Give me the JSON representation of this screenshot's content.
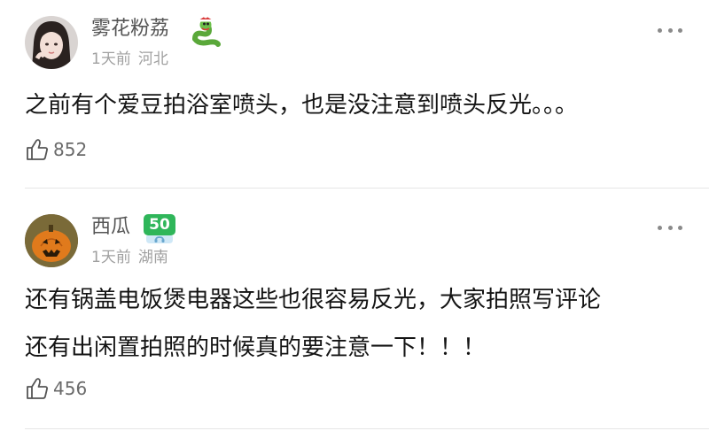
{
  "comments": [
    {
      "username": "雾花粉荔",
      "time": "1天前",
      "location": "河北",
      "text": "之前有个爱豆拍浴室喷头，也是没注意到喷头反光。。。",
      "likes": "852",
      "badge_icon": "snake-badge-icon"
    },
    {
      "username": "西瓜",
      "time": "1天前",
      "location": "湖南",
      "text_lines": [
        "还有锅盖电饭煲电器这些也很容易反光，大家拍照写评论",
        "还有出闲置拍照的时候真的要注意一下！！！"
      ],
      "likes": "456",
      "level": "50",
      "badge_icon": "level-badge-icon"
    }
  ],
  "colors": {
    "level_badge": "#2fb65a",
    "username": "#555555",
    "meta": "#a0a0a0"
  }
}
